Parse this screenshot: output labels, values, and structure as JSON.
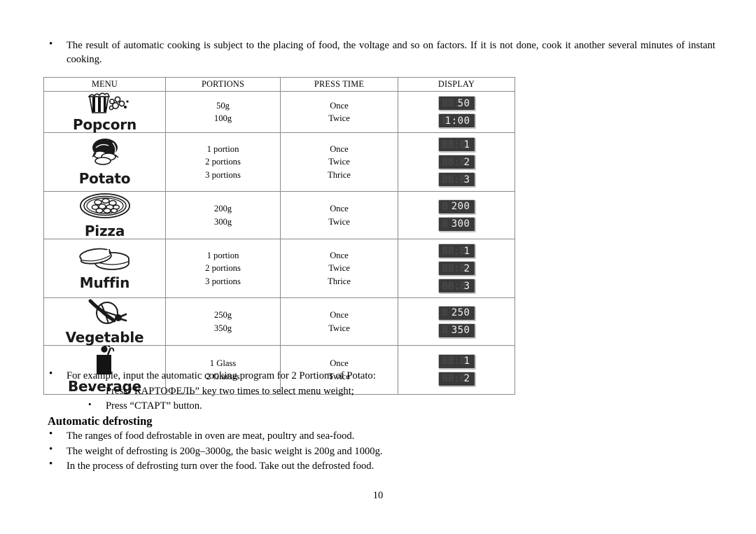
{
  "intro": {
    "bullet": "•",
    "text": "The result of automatic cooking is subject to the placing of food, the voltage and so on factors. If it is not done, cook it another several minutes of instant cooking."
  },
  "table": {
    "headers": [
      "MENU",
      "PORTIONS",
      "PRESS TIME",
      "DISPLAY"
    ],
    "rows": [
      {
        "menu": "Popcorn",
        "icon": "popcorn-icon",
        "portions": [
          "50g",
          "100g"
        ],
        "press_time": [
          "Once",
          "Twice"
        ],
        "display": [
          {
            "ghost": "88:",
            "value": "50"
          },
          {
            "ghost": "8",
            "value": "1:00"
          }
        ]
      },
      {
        "menu": "Potato",
        "icon": "potato-icon",
        "portions": [
          "1 portion",
          "2 portions",
          "3 portions"
        ],
        "press_time": [
          "Once",
          "Twice",
          "Thrice"
        ],
        "display": [
          {
            "ghost": "88:8",
            "value": "1"
          },
          {
            "ghost": "88:8",
            "value": "2"
          },
          {
            "ghost": "88:8",
            "value": "3"
          }
        ]
      },
      {
        "menu": "Pizza",
        "icon": "pizza-icon",
        "portions": [
          "200g",
          "300g"
        ],
        "press_time": [
          "Once",
          "Twice"
        ],
        "display": [
          {
            "ghost": "8",
            "value": "200"
          },
          {
            "ghost": "8",
            "value": "300"
          }
        ]
      },
      {
        "menu": "Muffin",
        "icon": "muffin-icon",
        "portions": [
          "1 portion",
          "2 portions",
          "3 portions"
        ],
        "press_time": [
          "Once",
          "Twice",
          "Thrice"
        ],
        "display": [
          {
            "ghost": "88:8",
            "value": "1"
          },
          {
            "ghost": "88:8",
            "value": "2"
          },
          {
            "ghost": "88:8",
            "value": "3"
          }
        ]
      },
      {
        "menu": "Vegetable",
        "icon": "vegetable-icon",
        "portions": [
          "250g",
          "350g"
        ],
        "press_time": [
          "Once",
          "Twice"
        ],
        "display": [
          {
            "ghost": "8",
            "value": "250"
          },
          {
            "ghost": "8",
            "value": "350"
          }
        ]
      },
      {
        "menu": "Beverage",
        "icon": "beverage-icon",
        "portions": [
          "1 Glass",
          "2 Glasses"
        ],
        "press_time": [
          "Once",
          "Twice"
        ],
        "display": [
          {
            "ghost": "88:8",
            "value": "1"
          },
          {
            "ghost": "88:8",
            "value": "2"
          }
        ]
      }
    ]
  },
  "example": {
    "bullet": "•",
    "sub_bullet": "•",
    "text": "For example, input the automatic cooking program for 2 Portions of Potato:",
    "steps": [
      "Press  “КАРТОФЕЛЬ” key two times to select menu weight;",
      "Press “СТАРТ” button."
    ]
  },
  "defrosting": {
    "title": "Automatic defrosting",
    "bullet": "•",
    "items": [
      "The ranges of food defrostable in oven are meat, poultry and sea-food.",
      "The weight of defrosting is 200g–3000g, the basic weight is 200g and 1000g.",
      "In the process of defrosting turn over the food. Take out the defrosted food."
    ]
  },
  "page_number": "10",
  "colors": {
    "lcd_background": "#3a3a3a",
    "lcd_digit": "#f2f2f2",
    "lcd_ghost": "#4e4e4e",
    "table_border": "#8a8a8a",
    "text": "#000000"
  }
}
